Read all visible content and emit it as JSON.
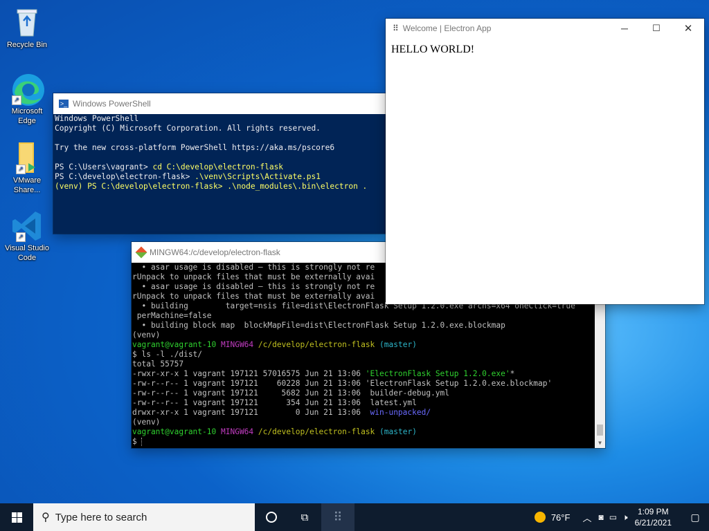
{
  "desktop": {
    "icons": [
      {
        "label": "Recycle Bin",
        "icon": "recycle-bin-icon"
      },
      {
        "label": "Microsoft Edge",
        "icon": "edge-icon"
      },
      {
        "label": "VMware Share...",
        "icon": "folder-icon"
      },
      {
        "label": "Visual Studio Code",
        "icon": "vscode-icon"
      }
    ]
  },
  "powershell": {
    "title": "Windows PowerShell",
    "lines": [
      "Windows PowerShell",
      "Copyright (C) Microsoft Corporation. All rights reserved.",
      "",
      "Try the new cross-platform PowerShell https://aka.ms/pscore6",
      "",
      "PS C:\\Users\\vagrant> ",
      "PS C:\\develop\\electron-flask> ",
      "(venv) PS C:\\develop\\electron-flask> "
    ],
    "cmds": [
      "cd C:\\develop\\electron-flask",
      ".\\venv\\Scripts\\Activate.ps1",
      ".\\node_modules\\.bin\\electron ."
    ]
  },
  "mingw": {
    "title": "MINGW64:/c/develop/electron-flask",
    "log": [
      "  • asar usage is disabled — this is strongly not re",
      "rUnpack to unpack files that must be externally avai",
      "  • asar usage is disabled — this is strongly not re",
      "rUnpack to unpack files that must be externally avai",
      "  • building        target=nsis file=dist\\ElectronFlask Setup 1.2.0.exe archs=x64 oneClick=true",
      " perMachine=false",
      "  • building block map  blockMapFile=dist\\ElectronFlask Setup 1.2.0.exe.blockmap",
      "(venv)"
    ],
    "prompt_user": "vagrant@vagrant-10",
    "prompt_sys": "MINGW64",
    "prompt_path": "/c/develop/electron-flask",
    "prompt_branch": "(master)",
    "cmd": "$ ls -l ./dist/",
    "total": "total 55757",
    "files": [
      {
        "meta": "-rwxr-xr-x 1 vagrant 197121 57016575 Jun 21 13:06 ",
        "name": "'ElectronFlask Setup 1.2.0.exe'",
        "suffix": "*",
        "color": "#2fd12f"
      },
      {
        "meta": "-rw-r--r-- 1 vagrant 197121    60228 Jun 21 13:06 ",
        "name": "'ElectronFlask Setup 1.2.0.exe.blockmap'",
        "suffix": "",
        "color": "#c0c0c0"
      },
      {
        "meta": "-rw-r--r-- 1 vagrant 197121     5682 Jun 21 13:06  ",
        "name": "builder-debug.yml",
        "suffix": "",
        "color": "#c0c0c0"
      },
      {
        "meta": "-rw-r--r-- 1 vagrant 197121      354 Jun 21 13:06  ",
        "name": "latest.yml",
        "suffix": "",
        "color": "#c0c0c0"
      },
      {
        "meta": "drwxr-xr-x 1 vagrant 197121        0 Jun 21 13:06  ",
        "name": "win-unpacked/",
        "suffix": "",
        "color": "#6a6aff"
      }
    ],
    "venv": "(venv)",
    "dollar": "$ "
  },
  "electron": {
    "title": "Welcome | Electron App",
    "content": "HELLO WORLD!"
  },
  "taskbar": {
    "search_placeholder": "Type here to search",
    "weather": "76°F",
    "time": "1:09 PM",
    "date": "6/21/2021"
  }
}
